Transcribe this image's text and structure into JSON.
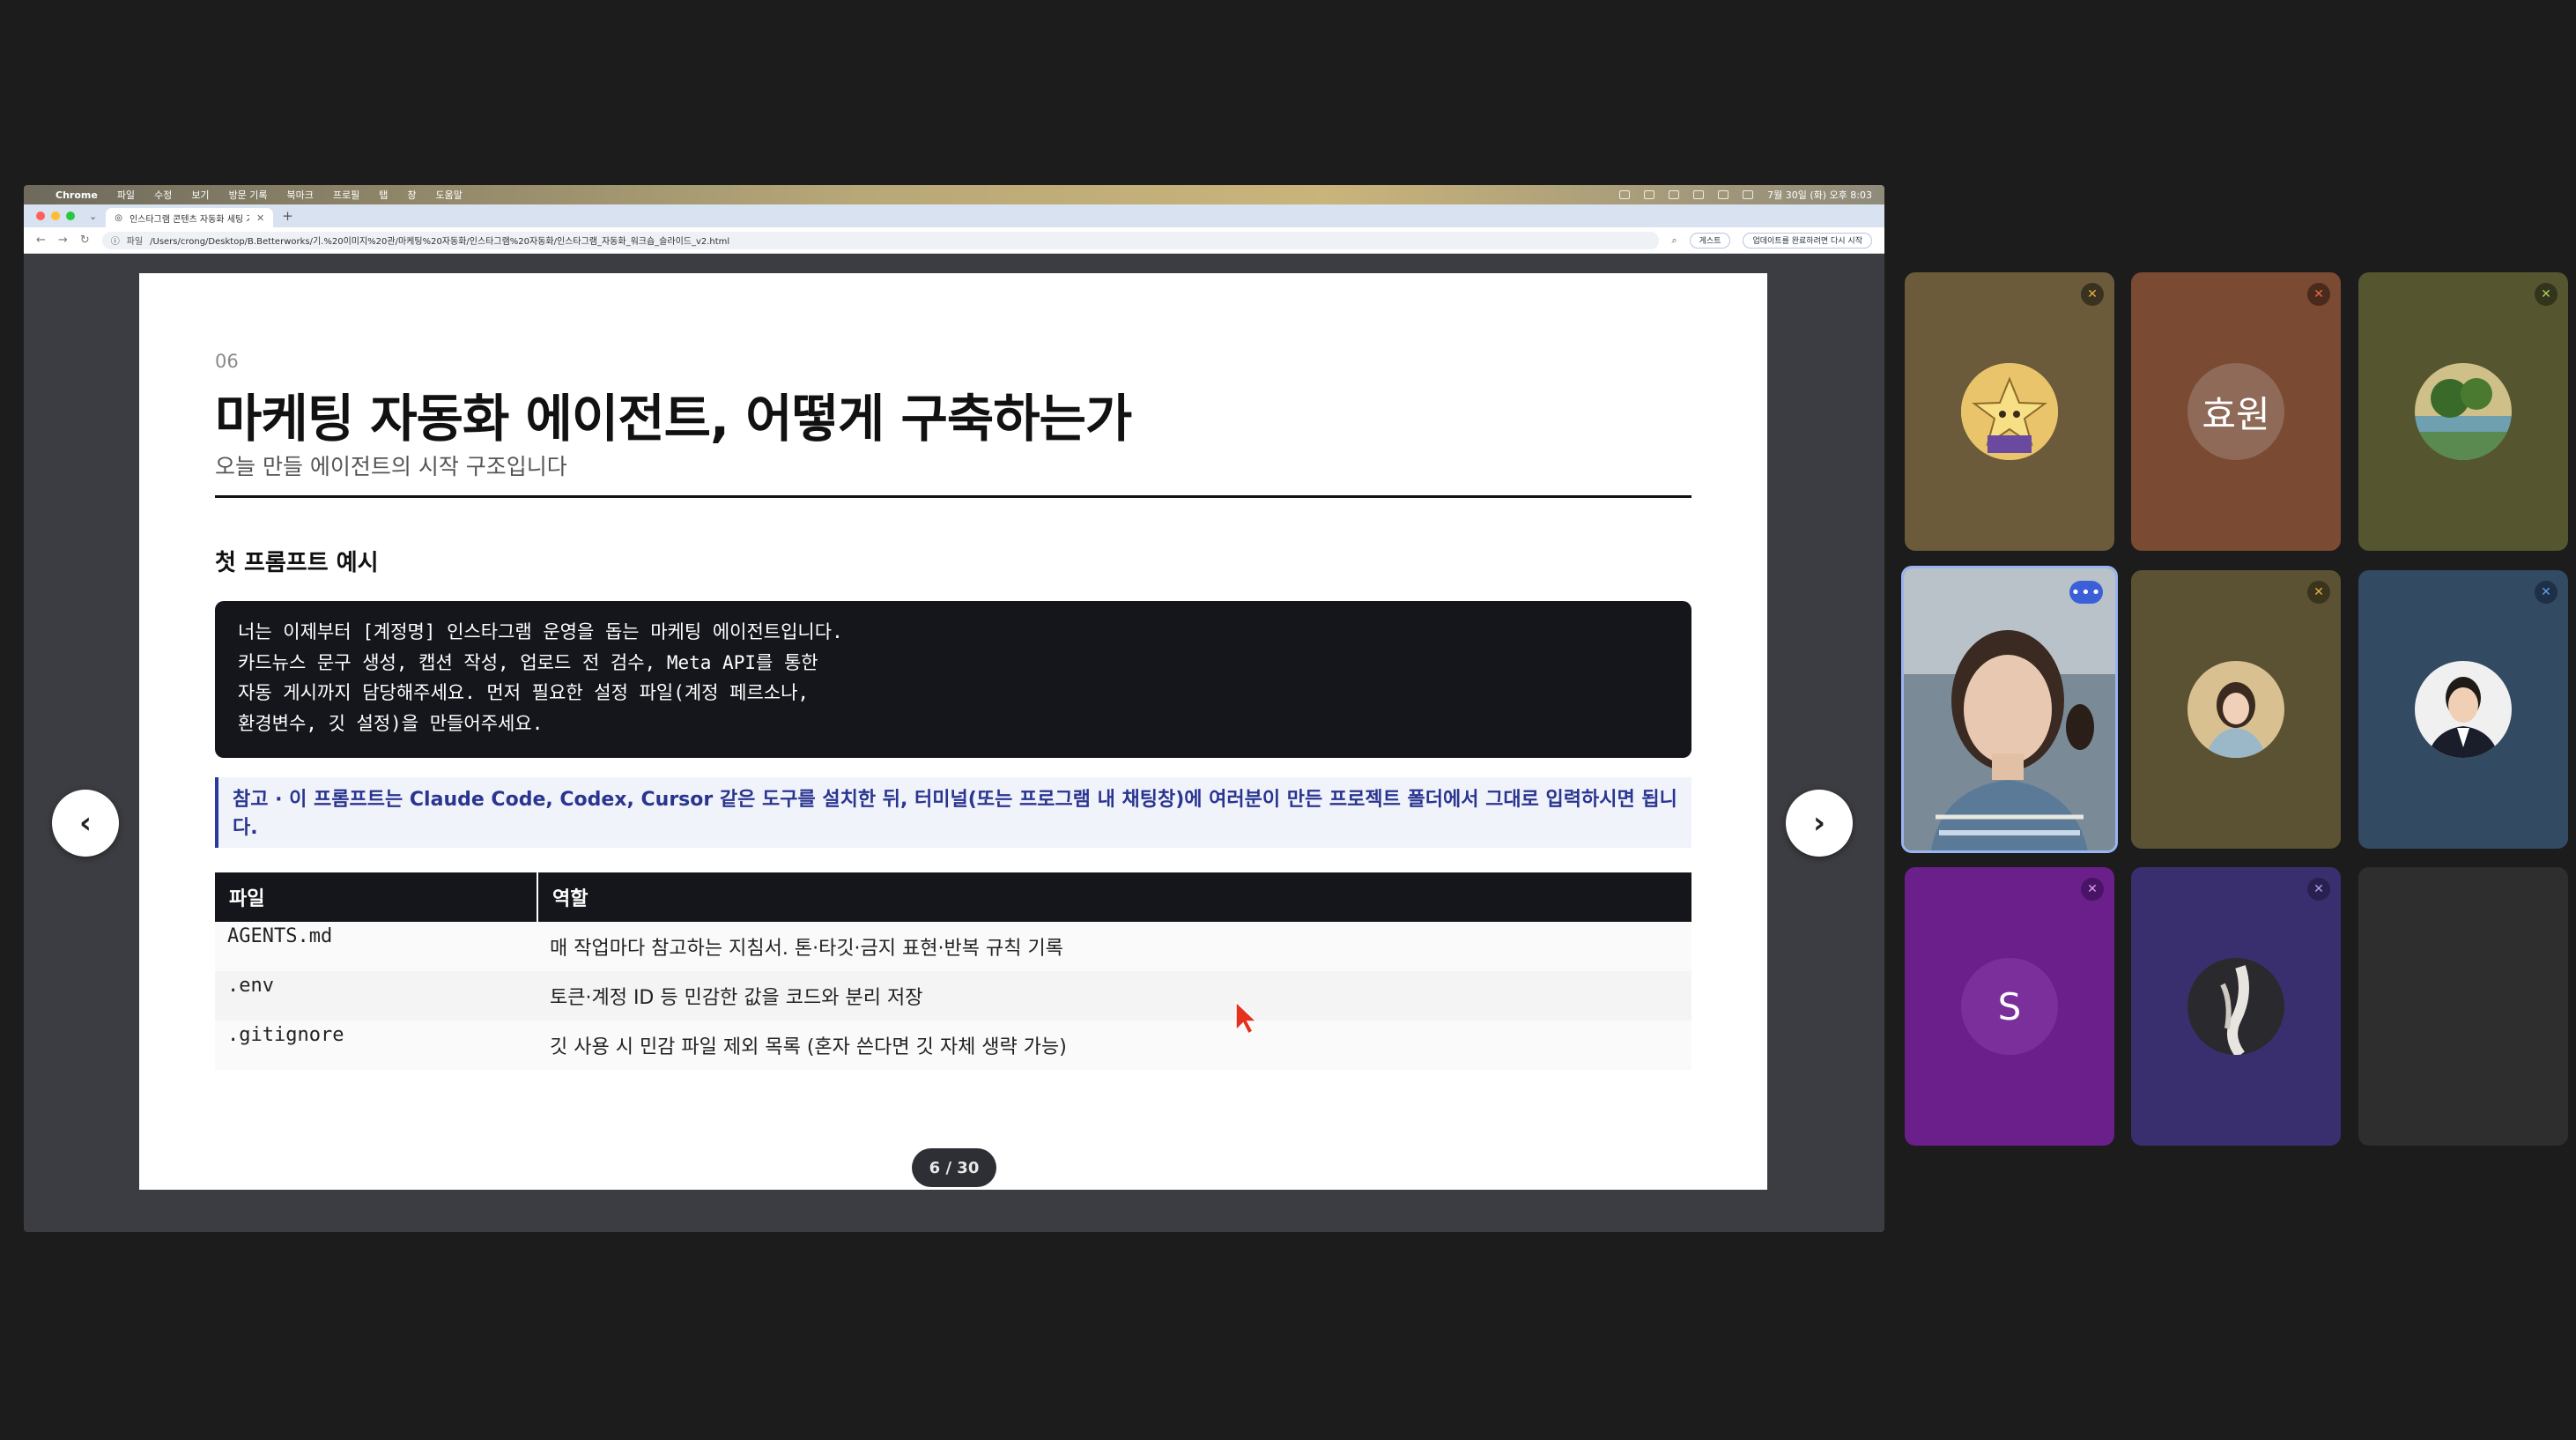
{
  "browser": {
    "app_name": "Chrome",
    "menu": [
      "파일",
      "수정",
      "보기",
      "방문 기록",
      "북마크",
      "프로필",
      "탭",
      "창",
      "도움말"
    ],
    "clock": "7월 30일 (화) 오후 8:03",
    "tab_title": "인스타그램 콘텐츠 자동화 세팅 가이",
    "omnibox_label": "파일",
    "url": "/Users/crong/Desktop/B.Betterworks/기.%20이미지%20관/마케팅%20자동화/인스타그램%20자동화/인스타그램_자동화_워크숍_슬라이드_v2.html",
    "chip_guest": "게스트",
    "chip_update": "업데이트를 완료하려면 다시 시작"
  },
  "slide": {
    "number": "06",
    "title": "마케팅 자동화 에이전트, 어떻게 구축하는가",
    "subtitle": "오늘 만들 에이전트의 시작 구조입니다",
    "section_title": "첫 프롬프트 예시",
    "code_lines": [
      "너는 이제부터 [계정명] 인스타그램 운영을 돕는 마케팅 에이전트입니다.",
      "카드뉴스 문구 생성, 캡션 작성, 업로드 전 검수, Meta API를 통한",
      "자동 게시까지 담당해주세요. 먼저 필요한 설정 파일(계정 페르소나,",
      "환경변수, 깃 설정)을 만들어주세요."
    ],
    "note": "참고 · 이 프롬프트는 Claude Code, Codex, Cursor 같은 도구를 설치한 뒤, 터미널(또는 프로그램 내 채팅창)에 여러분이 만든 프로젝트 폴더에서 그대로 입력하시면 됩니다.",
    "table": {
      "headers": [
        "파일",
        "역할"
      ],
      "rows": [
        [
          "AGENTS.md",
          "매 작업마다 참고하는 지침서. 톤·타깃·금지 표현·반복 규칙 기록"
        ],
        [
          ".env",
          "토큰·계정 ID 등 민감한 값을 코드와 분리 저장"
        ],
        [
          ".gitignore",
          "깃 사용 시 민감 파일 제외 목록 (혼자 쓴다면 깃 자체 생략 가능)"
        ]
      ]
    },
    "pager": "6 / 30",
    "prev_icon": "‹",
    "next_icon": "›"
  },
  "participants": [
    {
      "name_initial": "",
      "kind": "avatar-star",
      "bg": "#6b5b3a",
      "muted": true
    },
    {
      "name_initial": "효원",
      "kind": "initial",
      "bg": "#7a4a32",
      "circle": "#8f6a58",
      "muted": true
    },
    {
      "name_initial": "",
      "kind": "avatar-landscape",
      "bg": "#55562f",
      "muted": true
    },
    {
      "name_initial": "",
      "kind": "video",
      "bg": "#4a5a6e",
      "muted": false,
      "speaking": true
    },
    {
      "name_initial": "",
      "kind": "avatar-photo",
      "bg": "#5a5232",
      "muted": true
    },
    {
      "name_initial": "",
      "kind": "avatar-man",
      "bg": "#324a62",
      "muted": true
    },
    {
      "name_initial": "S",
      "kind": "initial",
      "bg": "#6a1f8a",
      "circle": "#7b2f9b",
      "muted": true
    },
    {
      "name_initial": "",
      "kind": "avatar-dancer",
      "bg": "#3a2f6e",
      "muted": true
    },
    {
      "name_initial": "",
      "kind": "empty",
      "bg": "#2e2e2e",
      "muted": false
    }
  ],
  "colors": {
    "page_bg": "#1c1c1c",
    "note_accent": "#2a3a9a",
    "speaking_border": "#9ab4f0",
    "muted_icon": "#e8b040"
  }
}
